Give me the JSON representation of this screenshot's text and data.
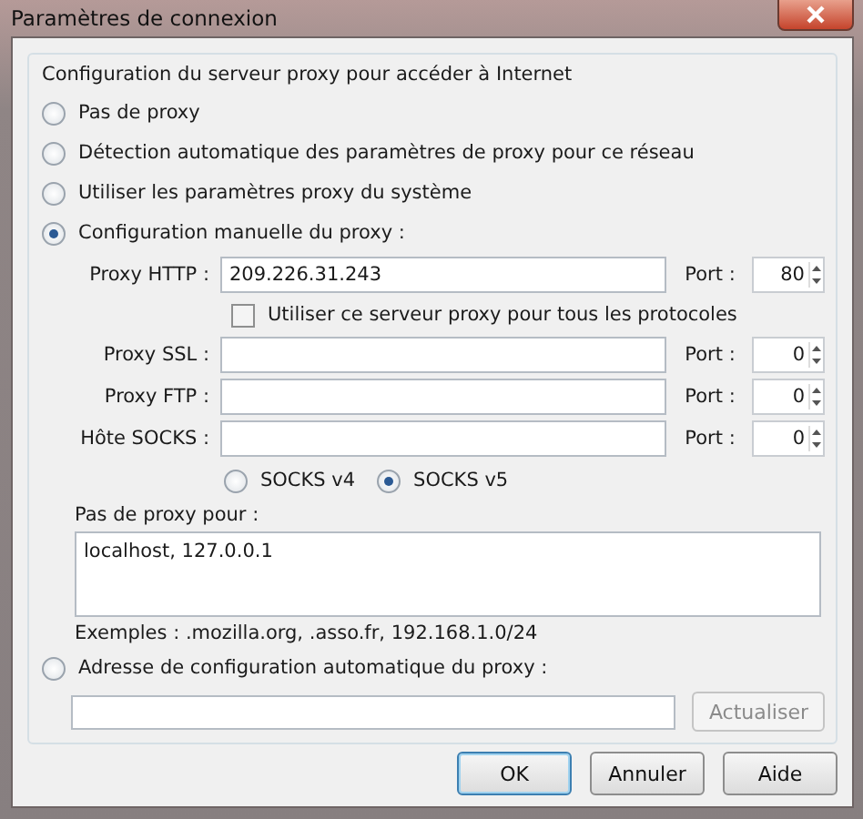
{
  "window": {
    "title": "Paramètres de connexion"
  },
  "group": {
    "title": "Configuration du serveur proxy pour accéder à Internet"
  },
  "modes": [
    {
      "label": "Pas de proxy",
      "selected": false
    },
    {
      "label": "Détection automatique des paramètres de proxy pour ce réseau",
      "selected": false
    },
    {
      "label": "Utiliser les paramètres proxy du système",
      "selected": false
    },
    {
      "label": "Configuration manuelle du proxy :",
      "selected": true
    }
  ],
  "proxies": [
    {
      "label": "Proxy HTTP :",
      "value": "209.226.31.243",
      "port_label": "Port :",
      "port": "80"
    },
    {
      "label": "Proxy SSL :",
      "port_label": "Port :",
      "port": "0"
    },
    {
      "label": "Proxy FTP :",
      "port_label": "Port :",
      "port": "0"
    },
    {
      "label": "Hôte SOCKS :",
      "port_label": "Port :",
      "port": "0"
    }
  ],
  "same_proxy": {
    "label": "Utiliser ce serveur proxy pour tous les protocoles",
    "checked": false
  },
  "socks_versions": [
    {
      "label": "SOCKS v4",
      "selected": false
    },
    {
      "label": "SOCKS v5",
      "selected": true
    }
  ],
  "no_proxy": {
    "label": "Pas de proxy pour :",
    "value": "localhost, 127.0.0.1",
    "example": "Exemples : .mozilla.org, .asso.fr, 192.168.1.0/24"
  },
  "auto_config": {
    "label": "Adresse de configuration automatique du proxy :",
    "selected": false,
    "reload_button": "Actualiser",
    "reload_disabled": true
  },
  "buttons": [
    {
      "label": "OK",
      "default": true
    },
    {
      "label": "Annuler",
      "default": false
    },
    {
      "label": "Aide",
      "default": false
    }
  ]
}
